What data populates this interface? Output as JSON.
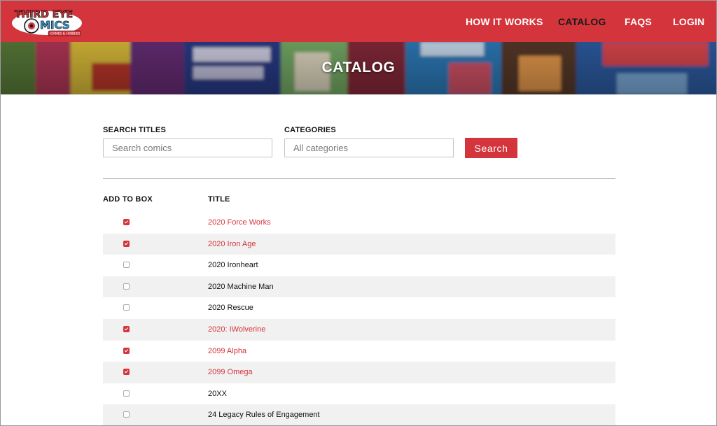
{
  "brand": {
    "logo_text": "THIRD EYE COMICS",
    "logo_sub": "GAMES & HOBBIES",
    "color": "#d4343b"
  },
  "nav": [
    {
      "label": "HOW IT WORKS",
      "active": false
    },
    {
      "label": "CATALOG",
      "active": true
    },
    {
      "label": "FAQS",
      "active": false
    },
    {
      "label": "LOGIN",
      "active": false
    }
  ],
  "banner": {
    "title": "CATALOG"
  },
  "search": {
    "titles_label": "SEARCH TITLES",
    "titles_placeholder": "Search comics",
    "categories_label": "CATEGORIES",
    "categories_placeholder": "All categories",
    "button_label": "Search"
  },
  "table": {
    "headers": {
      "add": "ADD TO BOX",
      "title": "TITLE"
    },
    "rows": [
      {
        "title": "2020 Force Works",
        "checked": true
      },
      {
        "title": "2020 Iron Age",
        "checked": true
      },
      {
        "title": "2020 Ironheart",
        "checked": false
      },
      {
        "title": "2020 Machine Man",
        "checked": false
      },
      {
        "title": "2020 Rescue",
        "checked": false
      },
      {
        "title": "2020: IWolverine",
        "checked": true
      },
      {
        "title": "2099 Alpha",
        "checked": true
      },
      {
        "title": "2099 Omega",
        "checked": true
      },
      {
        "title": "20XX",
        "checked": false
      },
      {
        "title": "24 Legacy Rules of Engagement",
        "checked": false
      }
    ]
  }
}
